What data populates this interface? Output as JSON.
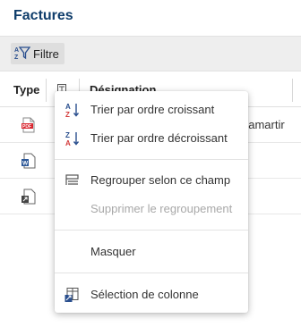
{
  "page": {
    "title": "Factures"
  },
  "toolbar": {
    "filter_label": "Filtre"
  },
  "grid": {
    "columns": {
      "type": "Type",
      "designation": "Désignation"
    },
    "rows": [
      {
        "icon": "pdf-file-icon",
        "text": "Lamartir"
      },
      {
        "icon": "word-file-icon",
        "text": ""
      },
      {
        "icon": "generic-file-icon",
        "text": ""
      }
    ]
  },
  "context_menu": {
    "items": [
      {
        "label": "Trier par ordre croissant",
        "icon": "sort-ascending-icon",
        "enabled": true
      },
      {
        "label": "Trier par ordre décroissant",
        "icon": "sort-descending-icon",
        "enabled": true
      },
      {
        "label": "Regrouper selon ce champ",
        "icon": "group-icon",
        "enabled": true
      },
      {
        "label": "Supprimer le regroupement",
        "icon": "",
        "enabled": false
      },
      {
        "label": "Masquer",
        "icon": "",
        "enabled": true
      },
      {
        "label": "Sélection de colonne",
        "icon": "column-selection-icon",
        "enabled": true
      }
    ]
  },
  "colors": {
    "title": "#0f3d6b",
    "sort_blue": "#2a4f8e",
    "sort_red": "#d33a3a",
    "pdf_red": "#d9262f"
  }
}
